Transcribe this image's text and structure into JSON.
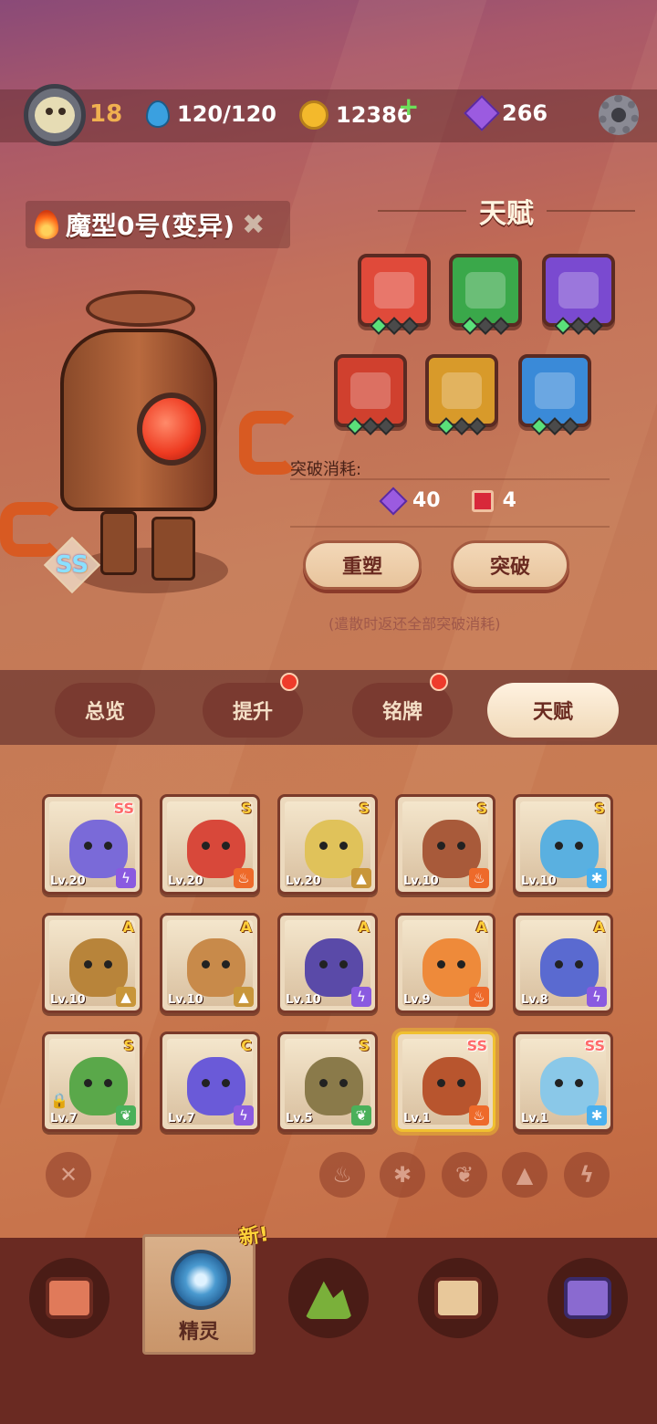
{
  "player": {
    "level": "18"
  },
  "resources": {
    "energy": "120/120",
    "coins": "12386",
    "gems": "266"
  },
  "hero": {
    "name": "魔型0号(变异)",
    "rank": "SS"
  },
  "talent": {
    "title": "天赋",
    "cost_label": "突破消耗:",
    "cost_gems": "40",
    "cost_books": "4",
    "reset_label": "重塑",
    "break_label": "突破",
    "note": "(遣散时返还全部突破消耗)",
    "slots": [
      {
        "name": "fang-talent",
        "color": "#e04a3a",
        "pips": 1
      },
      {
        "name": "claw-talent",
        "color": "#3aa84a",
        "pips": 1
      },
      {
        "name": "lightning-talent",
        "color": "#7a4ad0",
        "pips": 1
      },
      {
        "name": "blood-talent",
        "color": "#d0402e",
        "pips": 1
      },
      {
        "name": "wing-talent",
        "color": "#d89a2a",
        "pips": 1
      },
      {
        "name": "eye-talent",
        "color": "#3a8ad8",
        "pips": 1
      }
    ]
  },
  "tabs": [
    "总览",
    "提升",
    "铭牌",
    "天赋"
  ],
  "roster": [
    {
      "level": "Lv.20",
      "rank": "SS",
      "element": "lightning",
      "color": "#7a6ad8"
    },
    {
      "level": "Lv.20",
      "rank": "S",
      "element": "fire",
      "color": "#d8483a"
    },
    {
      "level": "Lv.20",
      "rank": "S",
      "element": "earth",
      "color": "#e0c25a"
    },
    {
      "level": "Lv.10",
      "rank": "S",
      "element": "fire",
      "color": "#a85a3a"
    },
    {
      "level": "Lv.10",
      "rank": "S",
      "element": "ice",
      "color": "#5ab0e0"
    },
    {
      "level": "Lv.10",
      "rank": "A",
      "element": "earth",
      "color": "#b8843a"
    },
    {
      "level": "Lv.10",
      "rank": "A",
      "element": "earth",
      "color": "#c88a4a"
    },
    {
      "level": "Lv.10",
      "rank": "A",
      "element": "lightning",
      "color": "#5a4aa8"
    },
    {
      "level": "Lv.9",
      "rank": "A",
      "element": "fire",
      "color": "#ee8a3a"
    },
    {
      "level": "Lv.8",
      "rank": "A",
      "element": "lightning",
      "color": "#5a6ad0"
    },
    {
      "level": "Lv.7",
      "rank": "S",
      "element": "leaf",
      "color": "#5aa84a"
    },
    {
      "level": "Lv.7",
      "rank": "C",
      "element": "lightning",
      "color": "#6a5ad8"
    },
    {
      "level": "Lv.5",
      "rank": "S",
      "element": "leaf",
      "color": "#8a7a4a"
    },
    {
      "level": "Lv.1",
      "rank": "SS",
      "element": "fire",
      "color": "#b8552e"
    },
    {
      "level": "Lv.1",
      "rank": "SS",
      "element": "ice",
      "color": "#8ac8e8"
    }
  ],
  "filters": [
    "clear",
    "fire",
    "ice",
    "leaf",
    "earth",
    "lightning"
  ],
  "nav": {
    "active_label": "精灵",
    "new_tag": "新!"
  },
  "colors": {
    "fire": "#ee6a2a",
    "ice": "#4ab0ee",
    "leaf": "#4ab05a",
    "earth": "#c8963a",
    "lightning": "#8a5ae0"
  }
}
